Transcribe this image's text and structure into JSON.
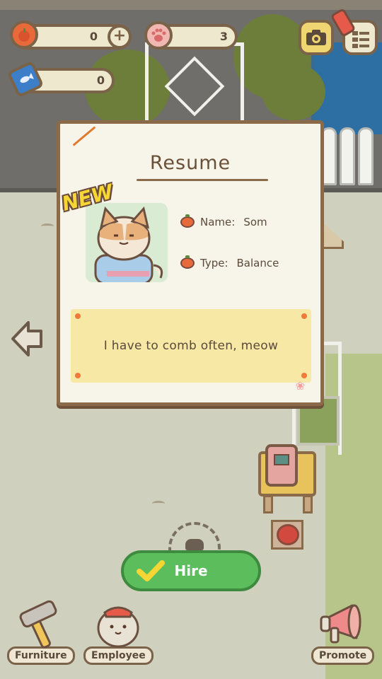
{
  "hud": {
    "apple_count": "0",
    "paw_count": "3",
    "fish_ticket_count": "0"
  },
  "resume": {
    "title": "Resume",
    "new_badge": "NEW",
    "name_label": "Name:",
    "name_value": "Som",
    "type_label": "Type:",
    "type_value": "Balance",
    "quote": "I have to comb often, meow"
  },
  "actions": {
    "hire_label": "Hire"
  },
  "nav": {
    "furniture_label": "Furniture",
    "employee_label": "Employee",
    "promote_label": "Promote"
  },
  "colors": {
    "card_background": "#f7f4ea",
    "card_border": "#8a6a48",
    "hire_green": "#5cbd5c",
    "quote_yellow": "#f8e8a6",
    "new_badge_yellow": "#f5d635"
  }
}
